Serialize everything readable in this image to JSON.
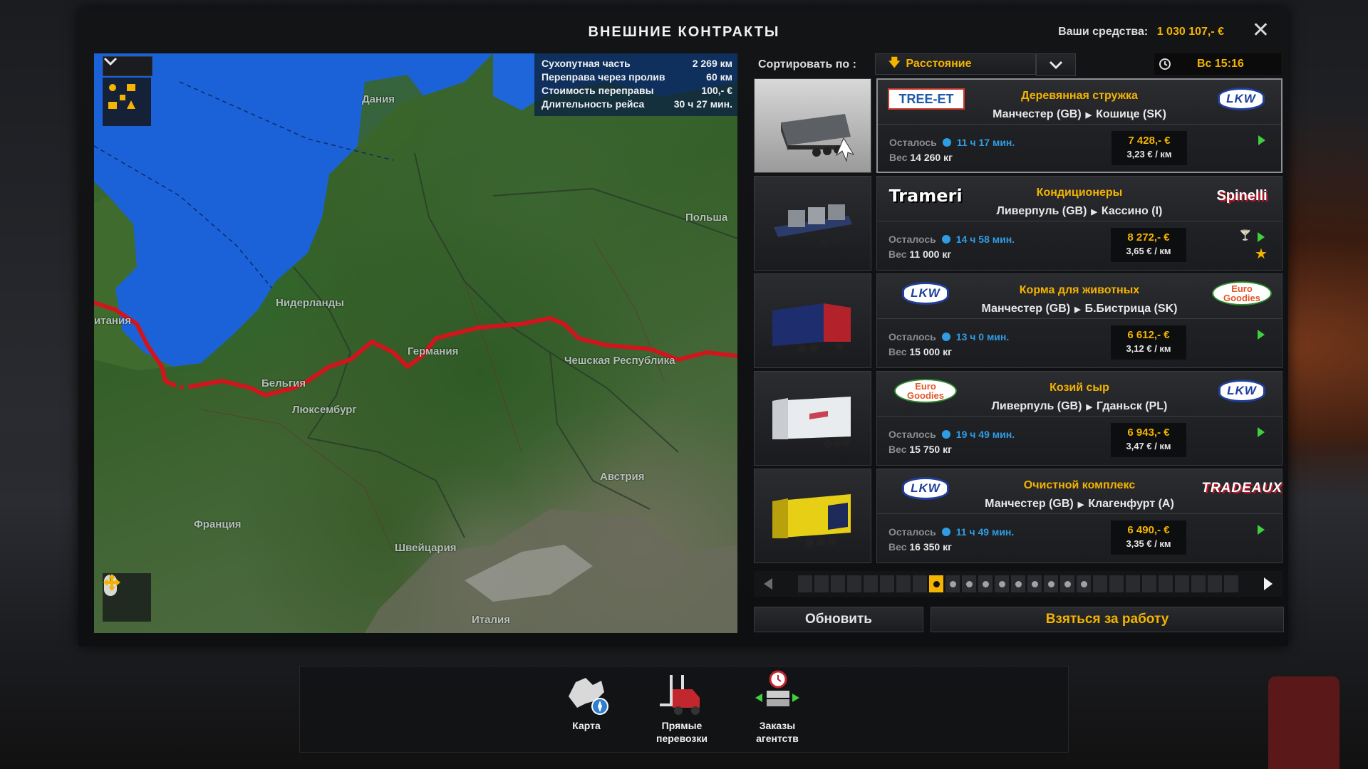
{
  "window": {
    "title": "ВНЕШНИЕ КОНТРАКТЫ",
    "funds_label": "Ваши средства:",
    "funds_value": "1 030 107,- €"
  },
  "map": {
    "info": [
      {
        "label": "Сухопутная часть",
        "value": "2 269 км"
      },
      {
        "label": "Переправа через пролив",
        "value": "60 км"
      },
      {
        "label": "Стоимость переправы",
        "value": "100,- €"
      },
      {
        "label": "Длительность рейса",
        "value": "30 ч 27 мин."
      }
    ],
    "labels": {
      "denmark": "Дания",
      "poland": "Польша",
      "netherlands": "Нидерланды",
      "britain": "итания",
      "germany": "Германия",
      "czech": "Чешская Республика",
      "belgium": "Бельгия",
      "luxembourg": "Люксембург",
      "austria": "Австрия",
      "france": "Франция",
      "switzerland": "Швейцария",
      "italy": "Италия"
    }
  },
  "sort": {
    "label": "Сортировать по :",
    "value": "Расстояние",
    "time": "Вс 15:16"
  },
  "contracts": [
    {
      "cargo": "Деревянная стружка",
      "from": "Манчестер (GB)",
      "to": "Кошице (SK)",
      "remaining_label": "Осталось",
      "time": "11 ч 17 мин.",
      "weight_label": "Вес",
      "weight": "14 260 кг",
      "price": "7 428,- €",
      "per_km": "3,23 € / км",
      "logo_left": "TREE-ET",
      "logo_right": "LKW"
    },
    {
      "cargo": "Кондиционеры",
      "from": "Ливерпуль (GB)",
      "to": "Кассино (I)",
      "remaining_label": "Осталось",
      "time": "14 ч 58 мин.",
      "weight_label": "Вес",
      "weight": "11 000 кг",
      "price": "8 272,- €",
      "per_km": "3,65 € / км",
      "logo_left": "Trameri",
      "logo_right": "Spinelli"
    },
    {
      "cargo": "Корма для животных",
      "from": "Манчестер (GB)",
      "to": "Б.Бистрица (SK)",
      "remaining_label": "Осталось",
      "time": "13 ч 0 мин.",
      "weight_label": "Вес",
      "weight": "15 000 кг",
      "price": "6 612,- €",
      "per_km": "3,12 € / км",
      "logo_left": "LKW",
      "logo_right_top": "Euro",
      "logo_right_bottom": "Goodies"
    },
    {
      "cargo": "Козий сыр",
      "from": "Ливерпуль (GB)",
      "to": "Гданьск (PL)",
      "remaining_label": "Осталось",
      "time": "19 ч 49 мин.",
      "weight_label": "Вес",
      "weight": "15 750 кг",
      "price": "6 943,- €",
      "per_km": "3,47 € / км",
      "logo_left_top": "Euro",
      "logo_left_bottom": "Goodies",
      "logo_right": "LKW"
    },
    {
      "cargo": "Очистной комплекс",
      "from": "Манчестер (GB)",
      "to": "Клагенфурт (A)",
      "remaining_label": "Осталось",
      "time": "11 ч 49 мин.",
      "weight_label": "Вес",
      "weight": "16 350 кг",
      "price": "6 490,- €",
      "per_km": "3,35 € / км",
      "logo_left": "LKW",
      "logo_right": "TRADEAUX"
    }
  ],
  "buttons": {
    "refresh": "Обновить",
    "take_job": "Взяться за работу"
  },
  "dock": {
    "map": "Карта",
    "direct_line1": "Прямые",
    "direct_line2": "перевозки",
    "agency_line1": "Заказы",
    "agency_line2": "агентств"
  },
  "colors": {
    "accent": "#f4b400",
    "route": "#d0161c",
    "time_blue": "#2f9de5",
    "go_green": "#3fcf3f"
  }
}
